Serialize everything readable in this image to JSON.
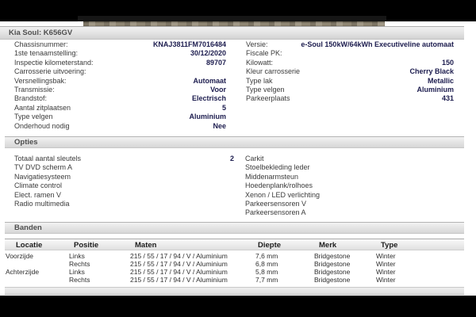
{
  "header": {
    "title": "Kia Soul: K656GV"
  },
  "vehicle_info": {
    "left": [
      {
        "label": "Chassisnummer:",
        "value": "KNAJ3811FM7016484"
      },
      {
        "label": "1ste tenaamstelling:",
        "value": "30/12/2020"
      },
      {
        "label": "Inspectie kilometerstand:",
        "value": "89707"
      },
      {
        "label": "Carrosserie uitvoering:",
        "value": ""
      },
      {
        "label": "Versnellingsbak:",
        "value": "Automaat"
      },
      {
        "label": "Transmissie:",
        "value": "Voor"
      },
      {
        "label": "Brandstof:",
        "value": "Electrisch"
      },
      {
        "label": "Aantal zitplaatsen",
        "value": "5"
      },
      {
        "label": "Type velgen",
        "value": "Aluminium"
      },
      {
        "label": "Onderhoud nodig",
        "value": "Nee"
      }
    ],
    "right": [
      {
        "label": "Versie:",
        "value": "e-Soul 150kW/64kWh Executiveline automaat"
      },
      {
        "label": "Fiscale PK:",
        "value": ""
      },
      {
        "label": "Kilowatt:",
        "value": "150"
      },
      {
        "label": "Kleur carrosserie",
        "value": "Cherry Black"
      },
      {
        "label": "Type lak",
        "value": "Metallic"
      },
      {
        "label": "Type velgen",
        "value": "Aluminium"
      },
      {
        "label": "Parkeerplaats",
        "value": "431"
      }
    ]
  },
  "opties": {
    "title": "Opties",
    "left": [
      {
        "label": "Totaal aantal sleutels",
        "value": "2"
      },
      {
        "label": "TV DVD scherm A",
        "value": ""
      },
      {
        "label": "Navigatiesysteem",
        "value": ""
      },
      {
        "label": "Climate control",
        "value": ""
      },
      {
        "label": "Elect. ramen V",
        "value": ""
      },
      {
        "label": "Radio multimedia",
        "value": ""
      }
    ],
    "right": [
      {
        "label": "Carkit"
      },
      {
        "label": "Stoelbekleding leder"
      },
      {
        "label": "Middenarmsteun"
      },
      {
        "label": "Hoedenplank/rolhoes"
      },
      {
        "label": "Xenon / LED verlichting"
      },
      {
        "label": "Parkeersensoren V"
      },
      {
        "label": "Parkeersensoren A"
      }
    ]
  },
  "banden": {
    "title": "Banden",
    "columns": [
      "Locatie",
      "Positie",
      "Maten",
      "Diepte",
      "Merk",
      "Type"
    ],
    "rows": [
      [
        "Voorzijde",
        "Links",
        "215 / 55 / 17 / 94 / V / Aluminium",
        "7,6 mm",
        "Bridgestone",
        "Winter"
      ],
      [
        "",
        "Rechts",
        "215 / 55 / 17 / 94 / V / Aluminium",
        "6,8 mm",
        "Bridgestone",
        "Winter"
      ],
      [
        "Achterzijde",
        "Links",
        "215 / 55 / 17 / 94 / V / Aluminium",
        "5,8 mm",
        "Bridgestone",
        "Winter"
      ],
      [
        "",
        "Rechts",
        "215 / 55 / 17 / 94 / V / Aluminium",
        "7,7 mm",
        "Bridgestone",
        "Winter"
      ]
    ]
  },
  "colors": {
    "frame": "#000000",
    "value_text": "#1c1c4e",
    "label_text": "#3b3b3b",
    "bar_text": "#4e4e4e"
  }
}
